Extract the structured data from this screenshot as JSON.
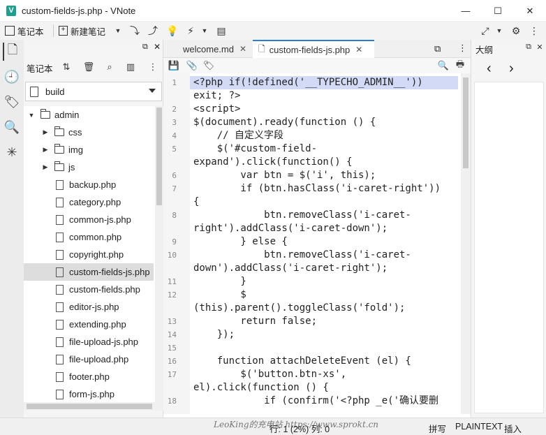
{
  "window": {
    "title": "custom-fields-js.php - VNote",
    "logo_letter": "V",
    "minimize": "—",
    "maximize": "☐",
    "close": "✕"
  },
  "toolbar": {
    "notebook_label": "笔记本",
    "new_note_label": "新建笔记"
  },
  "notebook_panel": {
    "toolbar_label": "笔记本",
    "selected_notebook": "build",
    "tree": [
      {
        "type": "folder",
        "name": "admin",
        "expanded": true,
        "depth": 0
      },
      {
        "type": "folder",
        "name": "css",
        "expanded": false,
        "depth": 1
      },
      {
        "type": "folder",
        "name": "img",
        "expanded": false,
        "depth": 1
      },
      {
        "type": "folder",
        "name": "js",
        "expanded": false,
        "depth": 1
      },
      {
        "type": "file",
        "name": "backup.php"
      },
      {
        "type": "file",
        "name": "category.php"
      },
      {
        "type": "file",
        "name": "common-js.php"
      },
      {
        "type": "file",
        "name": "common.php"
      },
      {
        "type": "file",
        "name": "copyright.php"
      },
      {
        "type": "file",
        "name": "custom-fields-js.php",
        "selected": true
      },
      {
        "type": "file",
        "name": "custom-fields.php"
      },
      {
        "type": "file",
        "name": "editor-js.php"
      },
      {
        "type": "file",
        "name": "extending.php"
      },
      {
        "type": "file",
        "name": "file-upload-js.php"
      },
      {
        "type": "file",
        "name": "file-upload.php"
      },
      {
        "type": "file",
        "name": "footer.php"
      },
      {
        "type": "file",
        "name": "form-js.php"
      }
    ]
  },
  "tabs": [
    {
      "label": "welcome.md",
      "active": false
    },
    {
      "label": "custom-fields-js.php",
      "active": true
    }
  ],
  "editor": {
    "lines": [
      {
        "num": "1",
        "text": "<?php if(!defined('__TYPECHO_ADMIN__'))",
        "highlight": true
      },
      {
        "num": "",
        "text": "exit; ?>"
      },
      {
        "num": "2",
        "text": "<script>"
      },
      {
        "num": "3",
        "text": "$(document).ready(function () {"
      },
      {
        "num": "4",
        "text": "    // 自定义字段"
      },
      {
        "num": "5",
        "text": "    $('#custom-field-"
      },
      {
        "num": "",
        "text": "expand').click(function() {"
      },
      {
        "num": "6",
        "text": "        var btn = $('i', this);"
      },
      {
        "num": "7",
        "text": "        if (btn.hasClass('i-caret-right'))"
      },
      {
        "num": "",
        "text": "{"
      },
      {
        "num": "8",
        "text": "            btn.removeClass('i-caret-"
      },
      {
        "num": "",
        "text": "right').addClass('i-caret-down');"
      },
      {
        "num": "9",
        "text": "        } else {"
      },
      {
        "num": "10",
        "text": "            btn.removeClass('i-caret-"
      },
      {
        "num": "",
        "text": "down').addClass('i-caret-right');"
      },
      {
        "num": "11",
        "text": "        }"
      },
      {
        "num": "12",
        "text": "        $"
      },
      {
        "num": "",
        "text": "(this).parent().toggleClass('fold');"
      },
      {
        "num": "13",
        "text": "        return false;"
      },
      {
        "num": "14",
        "text": "    });"
      },
      {
        "num": "15",
        "text": ""
      },
      {
        "num": "16",
        "text": "    function attachDeleteEvent (el) {"
      },
      {
        "num": "17",
        "text": "        $('button.btn-xs',"
      },
      {
        "num": "",
        "text": "el).click(function () {"
      },
      {
        "num": "18",
        "text": "            if (confirm('<?php _e('确认要删"
      }
    ]
  },
  "outline_panel": {
    "title": "大纲"
  },
  "statusbar": {
    "position": "行: 1 (2%)  列: 0",
    "input_method": "拼写",
    "mode": "PLAINTEXT",
    "insert": "插入",
    "watermark": "LeoKing的充电站  https://www.sprokt.cn"
  }
}
